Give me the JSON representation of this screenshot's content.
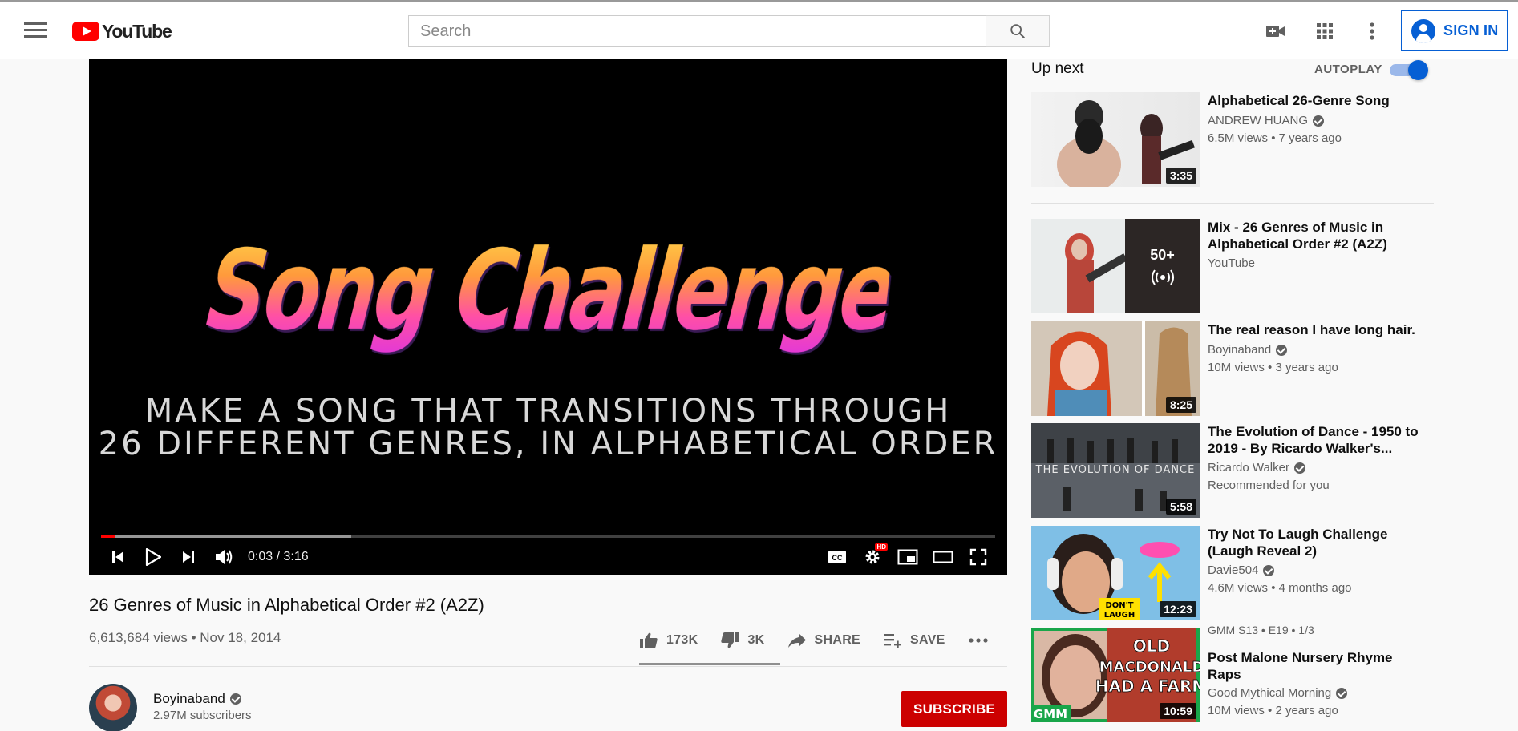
{
  "header": {
    "logo_text": "YouTube",
    "search_placeholder": "Search",
    "sign_in_label": "SIGN IN"
  },
  "player": {
    "art_title": "Song Challenge",
    "art_line1": "MAKE A SONG THAT TRANSITIONS THROUGH",
    "art_line2": "26 DIFFERENT GENRES, IN ALPHABETICAL ORDER",
    "time_display": "0:03 / 3:16",
    "progress_fraction": 0.016,
    "buffer_fraction": 0.28,
    "hd_badge": "HD"
  },
  "video": {
    "title": "26 Genres of Music in Alphabetical Order #2 (A2Z)",
    "meta": "6,613,684 views • Nov 18, 2014",
    "like_count": "173K",
    "dislike_count": "3K",
    "share_label": "SHARE",
    "save_label": "SAVE"
  },
  "channel": {
    "name": "Boyinaband",
    "subscribers": "2.97M subscribers",
    "subscribe_label": "SUBSCRIBE"
  },
  "sidebar": {
    "up_next_label": "Up next",
    "autoplay_label": "AUTOPLAY",
    "autoplay_on": true,
    "items": [
      {
        "title": "Alphabetical 26-Genre Song",
        "channel": "ANDREW HUANG",
        "verified": true,
        "meta": "6.5M views • 7 years ago",
        "duration": "3:35"
      },
      {
        "title": "Mix - 26 Genres of Music in Alphabetical Order #2 (A2Z)",
        "channel": "YouTube",
        "verified": false,
        "meta": "",
        "duration": "",
        "mix_count": "50+"
      },
      {
        "title": "The real reason I have long hair.",
        "channel": "Boyinaband",
        "verified": true,
        "meta": "10M views • 3 years ago",
        "duration": "8:25"
      },
      {
        "title": "The Evolution of Dance - 1950 to 2019 - By Ricardo Walker's...",
        "channel": "Ricardo Walker",
        "verified": true,
        "meta": "Recommended for you",
        "duration": "5:58",
        "thumb_text": "THE EVOLUTION OF DANCE"
      },
      {
        "title": "Try Not To Laugh Challenge (Laugh Reveal 2)",
        "channel": "Davie504",
        "verified": true,
        "meta": "4.6M views • 4 months ago",
        "duration": "12:23",
        "thumb_text": "DON'T LAUGH"
      },
      {
        "title": "Post Malone Nursery Rhyme Raps",
        "channel": "Good Mythical Morning",
        "verified": true,
        "meta": "10M views • 2 years ago",
        "duration": "10:59",
        "episode": "GMM  S13 • E19 • 1/3",
        "thumb_text": "OLD MACDONALD HAD A FARM",
        "thumb_brand": "GMM"
      }
    ]
  }
}
